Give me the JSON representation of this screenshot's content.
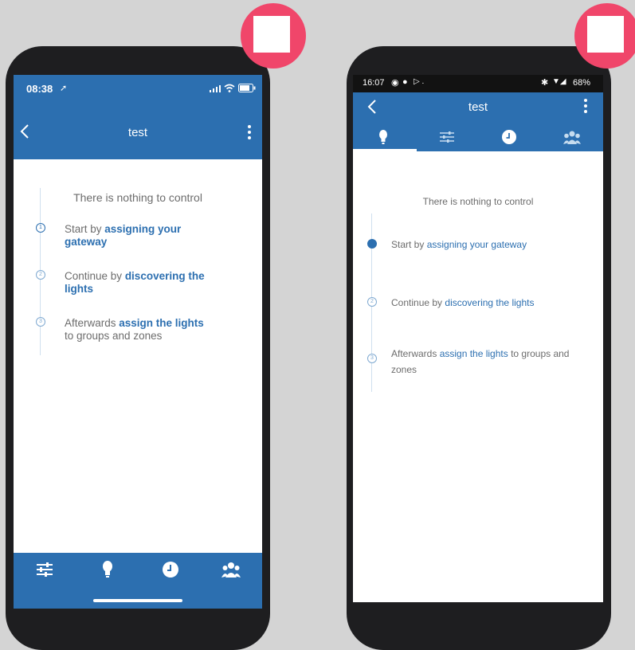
{
  "left": {
    "time": "08:38",
    "title": "test",
    "empty": "There is nothing to control",
    "steps": [
      {
        "pre": "Start by ",
        "link": "assigning your gateway",
        "post": "",
        "num": "1"
      },
      {
        "pre": "Continue by ",
        "link": "discovering the lights",
        "post": "",
        "num": "2"
      },
      {
        "pre": "Afterwards ",
        "link": "assign the lights",
        "post": " to groups and zones",
        "num": "3"
      }
    ]
  },
  "right": {
    "time": "16:07",
    "battery": "68%",
    "title": "test",
    "empty": "There is nothing to control",
    "steps": [
      {
        "pre": "Start by ",
        "link": "assigning your gateway",
        "post": "",
        "num": "1"
      },
      {
        "pre": "Continue by ",
        "link": "discovering the lights",
        "post": "",
        "num": "2"
      },
      {
        "pre": "Afterwards ",
        "link": "assign the lights",
        "post": " to groups and zones",
        "num": "3"
      }
    ]
  },
  "colors": {
    "accent": "#2c6fb0",
    "badge": "#f0466a",
    "bezel": "#1e1e20"
  },
  "icons": [
    "back-chevron-icon",
    "more-vert-icon",
    "sliders-icon",
    "bulb-icon",
    "clock-icon",
    "people-icon",
    "signal-icon",
    "wifi-icon",
    "battery-icon",
    "whatsapp-icon",
    "bluetooth-icon"
  ]
}
